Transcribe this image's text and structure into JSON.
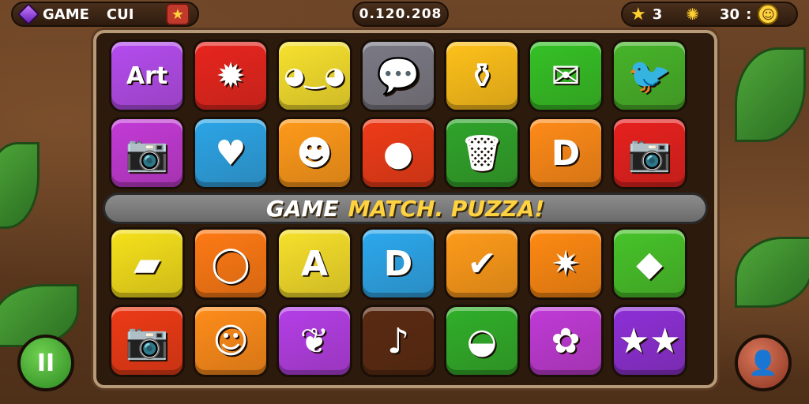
{
  "topbar": {
    "title_left": "GAME",
    "title_right": "CUI",
    "score": "0.120.208",
    "stars": "3",
    "suns": "30",
    "suns_suffix": ":"
  },
  "banner": {
    "text_white": "GAME",
    "text_yellow": "MATCH. PUZZA!"
  },
  "tiles": {
    "row1": [
      {
        "icon": "art-text-icon",
        "glyph": "Art",
        "color": "#b44cf0"
      },
      {
        "icon": "spiky-monster-icon",
        "glyph": "✹",
        "color": "#e8251e"
      },
      {
        "icon": "cow-face-icon",
        "glyph": "◕‿◕",
        "color": "#f7e22e"
      },
      {
        "icon": "chat-bubble-icon",
        "glyph": "💬",
        "color": "#7a7a86"
      },
      {
        "icon": "jar-icon",
        "glyph": "⚱",
        "color": "#ffc21a"
      },
      {
        "icon": "envelope-icon",
        "glyph": "✉",
        "color": "#34c226"
      },
      {
        "icon": "bird-icon",
        "glyph": "🐦",
        "color": "#46b52a"
      }
    ],
    "row2": [
      {
        "icon": "camera-icon",
        "glyph": "📷",
        "color": "#c33ad8"
      },
      {
        "icon": "heart-icon",
        "glyph": "♥",
        "color": "#2ba5e8"
      },
      {
        "icon": "purple-blob-icon",
        "glyph": "☻",
        "color": "#ff9a1a"
      },
      {
        "icon": "speech-bubble-icon",
        "glyph": "●",
        "color": "#ef3b18"
      },
      {
        "icon": "trash-can-icon",
        "glyph": "🗑",
        "color": "#2ea52b"
      },
      {
        "icon": "letter-d-icon",
        "glyph": "D",
        "color": "#ff8b18"
      },
      {
        "icon": "camera-icon",
        "glyph": "📷",
        "color": "#e8201e"
      }
    ],
    "row3": [
      {
        "icon": "folded-paper-icon",
        "glyph": "▰",
        "color": "#f6e21b"
      },
      {
        "icon": "speech-bubble-icon",
        "glyph": "◯",
        "color": "#ff7a14"
      },
      {
        "icon": "letter-a-icon",
        "glyph": "A",
        "color": "#f7e12b"
      },
      {
        "icon": "letter-d-icon",
        "glyph": "D",
        "color": "#2ba9ef"
      },
      {
        "icon": "checklist-icon",
        "glyph": "✔",
        "color": "#ff9c1a"
      },
      {
        "icon": "sun-burst-icon",
        "glyph": "✷",
        "color": "#ff8a12"
      },
      {
        "icon": "dice-creature-icon",
        "glyph": "◆",
        "color": "#46c42a"
      }
    ],
    "row4": [
      {
        "icon": "camera-icon",
        "glyph": "📷",
        "color": "#ee3a16"
      },
      {
        "icon": "owl-creature-icon",
        "glyph": "☺",
        "color": "#ff8d1a"
      },
      {
        "icon": "leaf-icon",
        "glyph": "❦",
        "color": "#b43ee8"
      },
      {
        "icon": "music-note-icon",
        "glyph": "♪",
        "color": "#5a2a12"
      },
      {
        "icon": "bell-face-icon",
        "glyph": "◒",
        "color": "#2faf2a"
      },
      {
        "icon": "bug-creature-icon",
        "glyph": "✿",
        "color": "#c03ad8"
      },
      {
        "icon": "two-stars-icon",
        "glyph": "★★",
        "color": "#8d2fd8"
      }
    ]
  },
  "buttons": {
    "pause_glyph": "II",
    "profile_glyph": "👤"
  }
}
